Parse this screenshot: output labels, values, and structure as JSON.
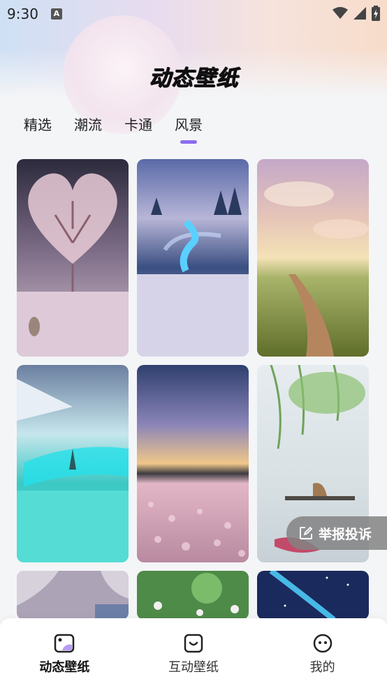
{
  "status_bar": {
    "time": "9:30",
    "icon_a": "A"
  },
  "app": {
    "title": "动态壁纸"
  },
  "tabs": [
    {
      "label": "精选",
      "active": false
    },
    {
      "label": "潮流",
      "active": false
    },
    {
      "label": "卡通",
      "active": false
    },
    {
      "label": "风景",
      "active": true
    }
  ],
  "wallpapers": [
    {
      "id": "heart-tree-snow",
      "icon": "image"
    },
    {
      "id": "glowing-river-snow",
      "icon": "image"
    },
    {
      "id": "meadow-path-sunset",
      "icon": "image"
    },
    {
      "id": "turquoise-stream",
      "icon": "image"
    },
    {
      "id": "flower-field-clouds",
      "icon": "image"
    },
    {
      "id": "boat-willow-lake",
      "icon": "image"
    },
    {
      "id": "pink-sky-fragment",
      "icon": "image"
    },
    {
      "id": "green-bokeh-flowers",
      "icon": "image"
    },
    {
      "id": "starry-aurora",
      "icon": "image"
    }
  ],
  "report_button": {
    "label": "举报投诉"
  },
  "bottom_nav": [
    {
      "label": "动态壁纸",
      "icon": "live-wallpaper-icon",
      "active": true
    },
    {
      "label": "互动壁纸",
      "icon": "interactive-wallpaper-icon",
      "active": false
    },
    {
      "label": "我的",
      "icon": "profile-face-icon",
      "active": false
    }
  ],
  "colors": {
    "accent": "#8b6cf0",
    "nav_icon": "#222222"
  }
}
